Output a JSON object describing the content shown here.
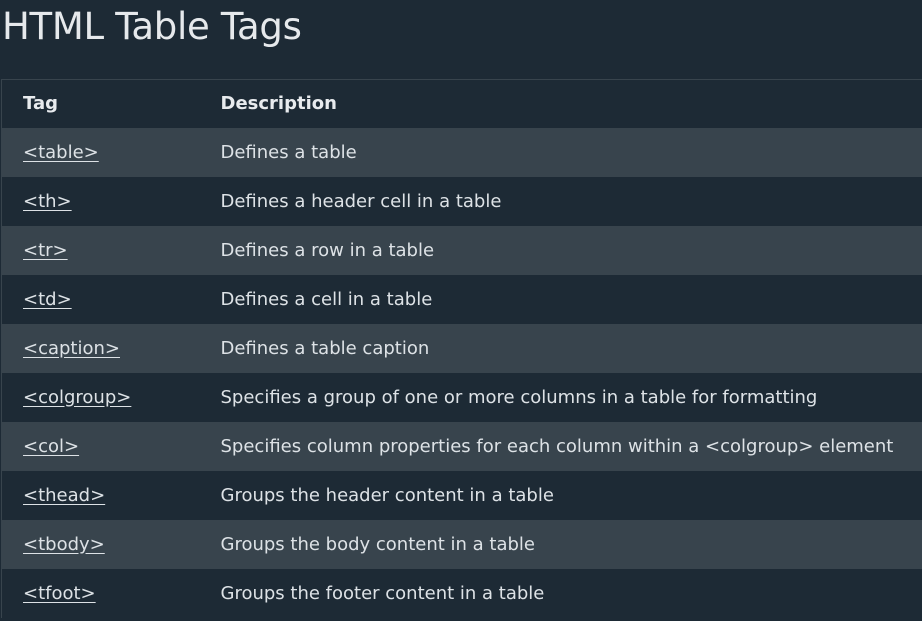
{
  "page": {
    "title": "HTML Table Tags"
  },
  "table": {
    "headers": {
      "tag": "Tag",
      "description": "Description"
    },
    "rows": [
      {
        "tag": "<table>",
        "description": "Defines a table"
      },
      {
        "tag": "<th>",
        "description": "Defines a header cell in a table"
      },
      {
        "tag": "<tr>",
        "description": "Defines a row in a table"
      },
      {
        "tag": "<td>",
        "description": "Defines a cell in a table"
      },
      {
        "tag": "<caption>",
        "description": "Defines a table caption"
      },
      {
        "tag": "<colgroup>",
        "description": "Specifies a group of one or more columns in a table for formatting"
      },
      {
        "tag": "<col>",
        "description": "Specifies column properties for each column within a <colgroup> element"
      },
      {
        "tag": "<thead>",
        "description": "Groups the header content in a table"
      },
      {
        "tag": "<tbody>",
        "description": "Groups the body content in a table"
      },
      {
        "tag": "<tfoot>",
        "description": "Groups the footer content in a table"
      }
    ]
  },
  "colors": {
    "background": "#1d2a35",
    "stripe": "#38444d",
    "text": "#dde2e6"
  }
}
